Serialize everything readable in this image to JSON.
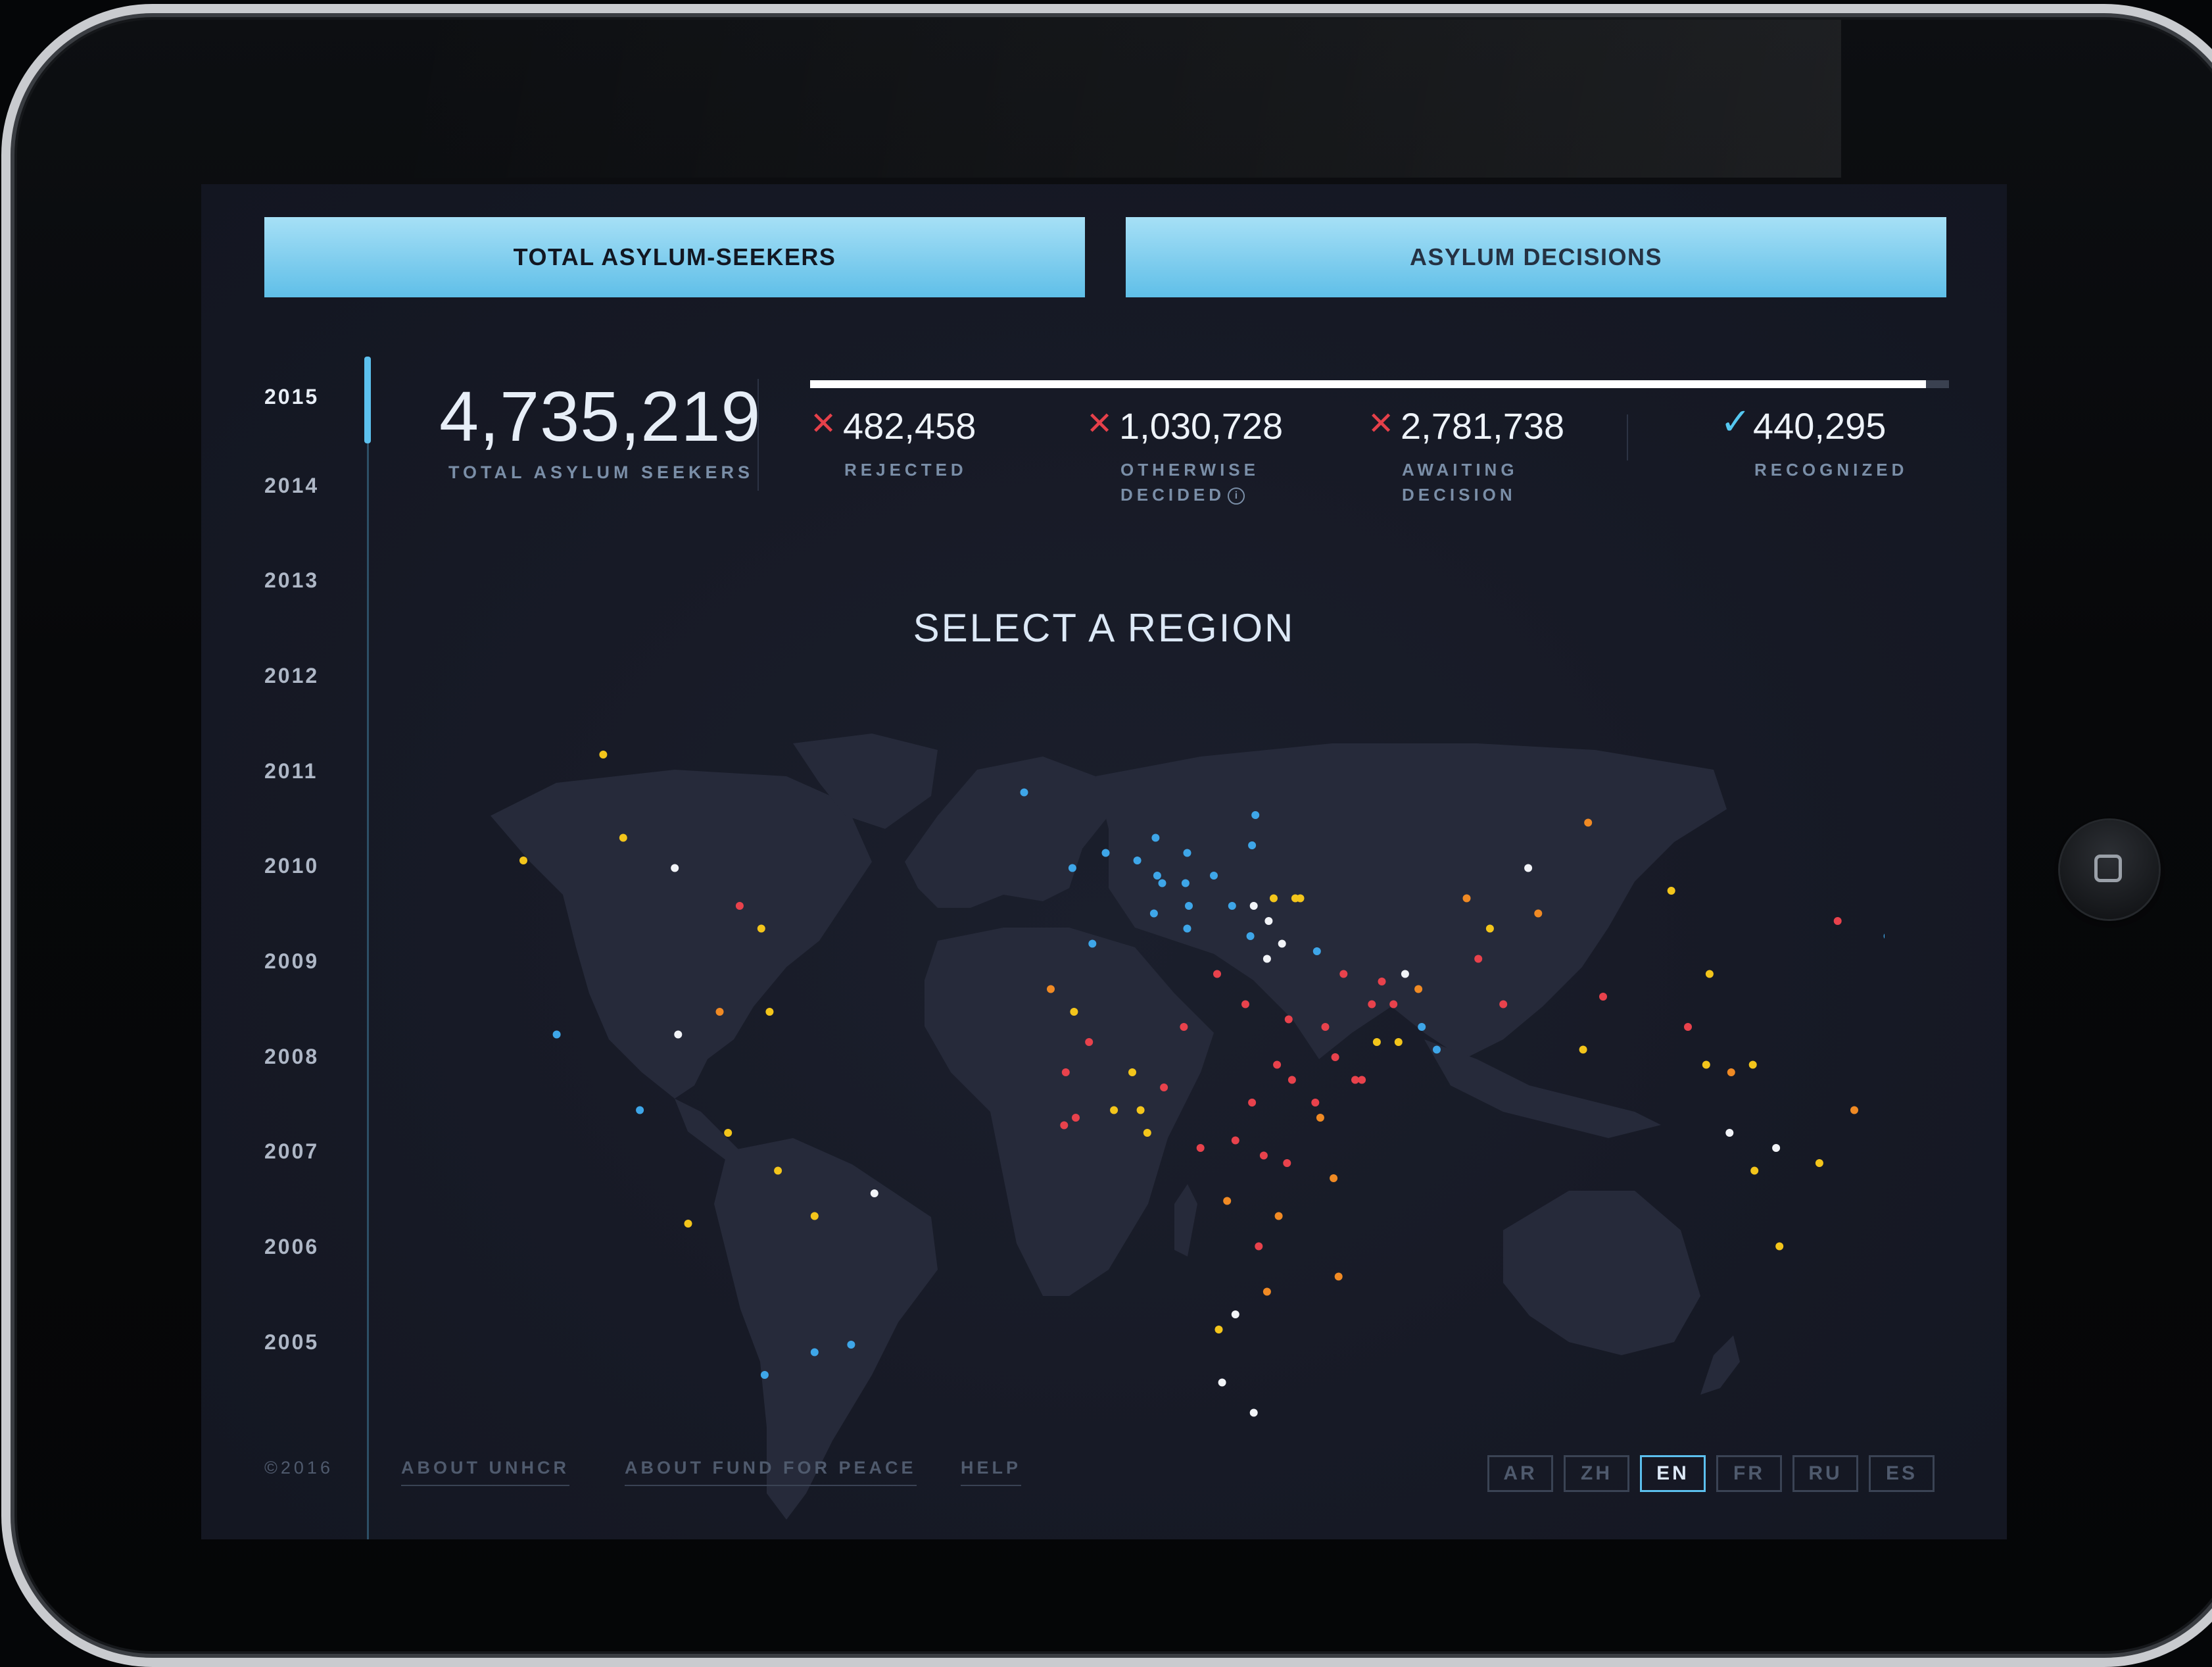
{
  "tabs": {
    "total_label": "TOTAL ASYLUM-SEEKERS",
    "decisions_label": "ASYLUM DECISIONS"
  },
  "years": [
    "2015",
    "2014",
    "2013",
    "2012",
    "2011",
    "2010",
    "2009",
    "2008",
    "2007",
    "2006",
    "2005"
  ],
  "selected_year": "2015",
  "totals": {
    "value": "4,735,219",
    "label": "TOTAL ASYLUM SEEKERS"
  },
  "decisions_progress": 0.98,
  "stats": {
    "rejected": {
      "value": "482,458",
      "label": "REJECTED",
      "icon": "x-icon"
    },
    "otherwise_decided": {
      "value": "1,030,728",
      "label_line1": "OTHERWISE",
      "label_line2": "DECIDED",
      "icon": "x-icon",
      "info": "i"
    },
    "awaiting": {
      "value": "2,781,738",
      "label_line1": "AWAITING",
      "label_line2": "DECISION",
      "icon": "x-icon"
    },
    "recognized": {
      "value": "440,295",
      "label": "RECOGNIZED",
      "icon": "check-icon"
    }
  },
  "map": {
    "title": "SELECT A REGION",
    "colors": {
      "land": "#262a3a",
      "blue": "#3ea6e8",
      "yellow": "#f3c51b",
      "orange": "#f08a24",
      "red": "#e8424c",
      "white": "#f2f4f8"
    }
  },
  "footer": {
    "copyright": "©2016",
    "about_unhcr": "ABOUT UNHCR",
    "about_ffp": "ABOUT FUND FOR PEACE",
    "help": "HELP"
  },
  "languages": [
    "AR",
    "ZH",
    "EN",
    "FR",
    "RU",
    "ES"
  ],
  "selected_language": "EN",
  "colors": {
    "accent": "#5cc0ee",
    "screen_bg": "#171a26",
    "x_mark": "#e5404a"
  }
}
